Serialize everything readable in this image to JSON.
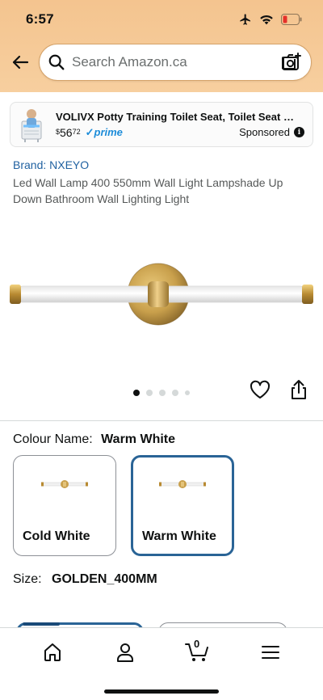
{
  "status": {
    "time": "6:57"
  },
  "search": {
    "placeholder": "Search Amazon.ca"
  },
  "ad": {
    "title": "VOLIVX Potty Training Toilet Seat, Toilet Seat and...",
    "price_currency": "$",
    "price_whole": "56",
    "price_cents": "72",
    "prime": "prime",
    "sponsored": "Sponsored"
  },
  "product": {
    "brand": "Brand: NXEYO",
    "title": "Led Wall Lamp 400 550mm Wall Light Lampshade Up Down Bathroom Wall Lighting Light",
    "image_count": 5,
    "active_image": 1
  },
  "colour": {
    "label": "Colour Name:",
    "selected": "Warm White",
    "options": [
      {
        "label": "Cold White",
        "selected": false
      },
      {
        "label": "Warm White",
        "selected": true
      }
    ]
  },
  "size": {
    "label": "Size:",
    "selected": "GOLDEN_400MM"
  },
  "nav": {
    "cart_count": "0"
  },
  "colors": {
    "header_bg": "#f6c998",
    "link": "#2162a1",
    "selected_border": "#2a6496",
    "prime": "#1c8cd9"
  },
  "icons": [
    "back-arrow-icon",
    "search-icon",
    "camera-icon",
    "heart-icon",
    "share-icon",
    "home-icon",
    "account-icon",
    "cart-icon",
    "menu-icon"
  ]
}
